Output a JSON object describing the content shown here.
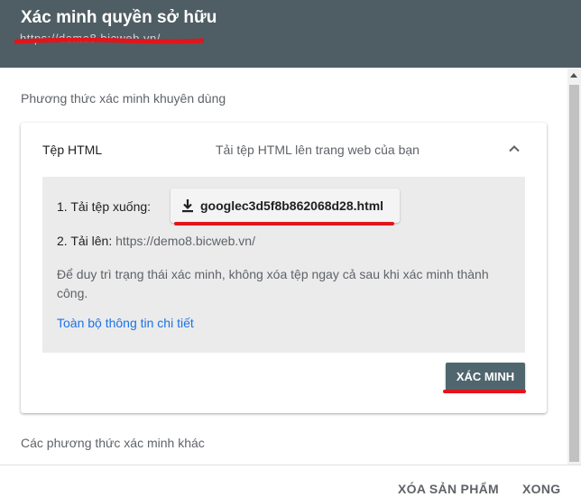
{
  "header": {
    "title": "Xác minh quyền sở hữu",
    "url": "https://demo8.bicweb.vn/"
  },
  "recommended": {
    "section_title": "Phương thức xác minh khuyên dùng",
    "card": {
      "label": "Tệp HTML",
      "description": "Tải tệp HTML lên trang web của bạn",
      "step1_label": "1. Tải tệp xuống:",
      "download_filename": "googlec3d5f8b862068d28.html",
      "step2_label": "2. Tải lên:",
      "step2_url": "https://demo8.bicweb.vn/",
      "note": "Để duy trì trạng thái xác minh, không xóa tệp ngay cả sau khi xác minh thành công.",
      "details_link": "Toàn bộ thông tin chi tiết",
      "verify_button": "XÁC MINH"
    }
  },
  "other_methods": {
    "section_title": "Các phương thức xác minh khác"
  },
  "footer": {
    "remove_button": "XÓA SẢN PHẨM",
    "done_button": "XONG"
  },
  "colors": {
    "header_bg": "#4f5e64",
    "accent_link": "#1a73e8",
    "verify_bg": "#50666e",
    "annotation_red": "#e3141b"
  },
  "icons": {
    "download": "download-icon",
    "collapse": "chevron-up-icon"
  }
}
